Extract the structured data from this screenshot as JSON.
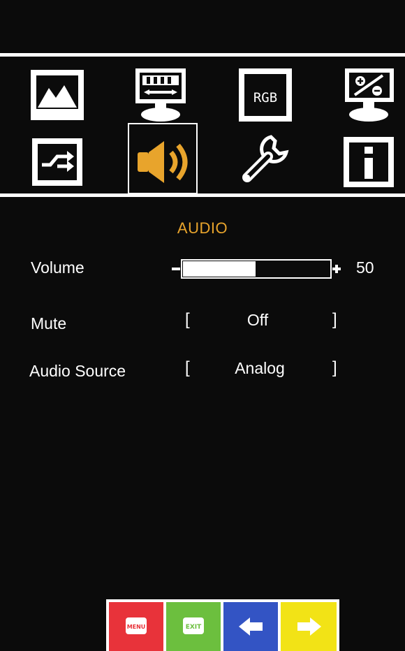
{
  "menu": {
    "title": "AUDIO",
    "rgb_icon_text": "RGB",
    "selected_icon": "audio",
    "accent_color": "#e8a42c",
    "icons_top": [
      "picture-icon",
      "display-position-icon",
      "rgb-icon",
      "percent-display-icon"
    ],
    "icons_bottom": [
      "input-switch-icon",
      "speaker-icon",
      "wrench-icon",
      "info-icon"
    ]
  },
  "settings": {
    "volume": {
      "label": "Volume",
      "value": "50",
      "level_percent": 50
    },
    "mute": {
      "label": "Mute",
      "bracket_open": "[",
      "value": "Off",
      "bracket_close": "]"
    },
    "audio_source": {
      "label": "Audio Source",
      "bracket_open": "[",
      "value": "Analog",
      "bracket_close": "]"
    }
  },
  "footer": {
    "menu_key_text": "MENU",
    "exit_key_text": "EXIT",
    "colors": {
      "menu": "#e8333a",
      "exit": "#6cbf3e",
      "left": "#3354c4",
      "right": "#f2e316"
    }
  }
}
